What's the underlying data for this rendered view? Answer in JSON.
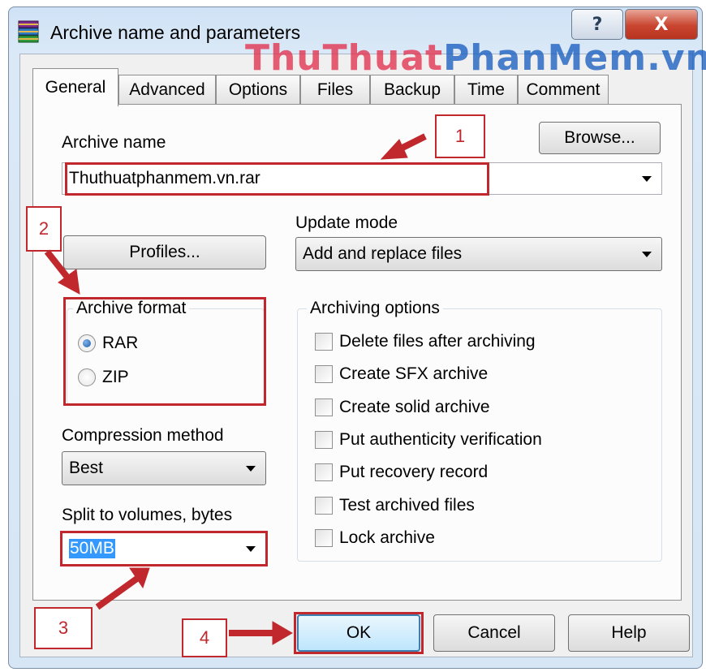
{
  "window": {
    "title": "Archive name and parameters",
    "icon": "winrar-books-icon",
    "help_glyph": "?",
    "close_glyph": "X"
  },
  "watermark": {
    "text_part1": "ThuThuat",
    "text_part2": "PhanMem",
    "text_part3": ".vn",
    "colors": [
      "#e3324f",
      "#1a5fc0"
    ]
  },
  "tabs": [
    "General",
    "Advanced",
    "Options",
    "Files",
    "Backup",
    "Time",
    "Comment"
  ],
  "active_tab": "General",
  "archive_name": {
    "label": "Archive name",
    "value": "Thuthuatphanmem.vn.rar",
    "browse": "Browse..."
  },
  "profiles_button": "Profiles...",
  "update_mode": {
    "label": "Update mode",
    "value": "Add and replace files"
  },
  "archive_format": {
    "label": "Archive format",
    "options": [
      "RAR",
      "ZIP"
    ],
    "selected": "RAR"
  },
  "compression": {
    "label": "Compression method",
    "value": "Best"
  },
  "split": {
    "label": "Split to volumes, bytes",
    "value": "50MB"
  },
  "archiving_options": {
    "label": "Archiving options",
    "items": [
      "Delete files after archiving",
      "Create SFX archive",
      "Create solid archive",
      "Put authenticity verification",
      "Put recovery record",
      "Test archived files",
      "Lock archive"
    ],
    "checked": [
      false,
      false,
      false,
      false,
      false,
      false,
      false
    ]
  },
  "buttons": {
    "ok": "OK",
    "cancel": "Cancel",
    "help": "Help"
  },
  "annotations": {
    "color": "#c0282d",
    "numbers": [
      "1",
      "2",
      "3",
      "4"
    ]
  }
}
